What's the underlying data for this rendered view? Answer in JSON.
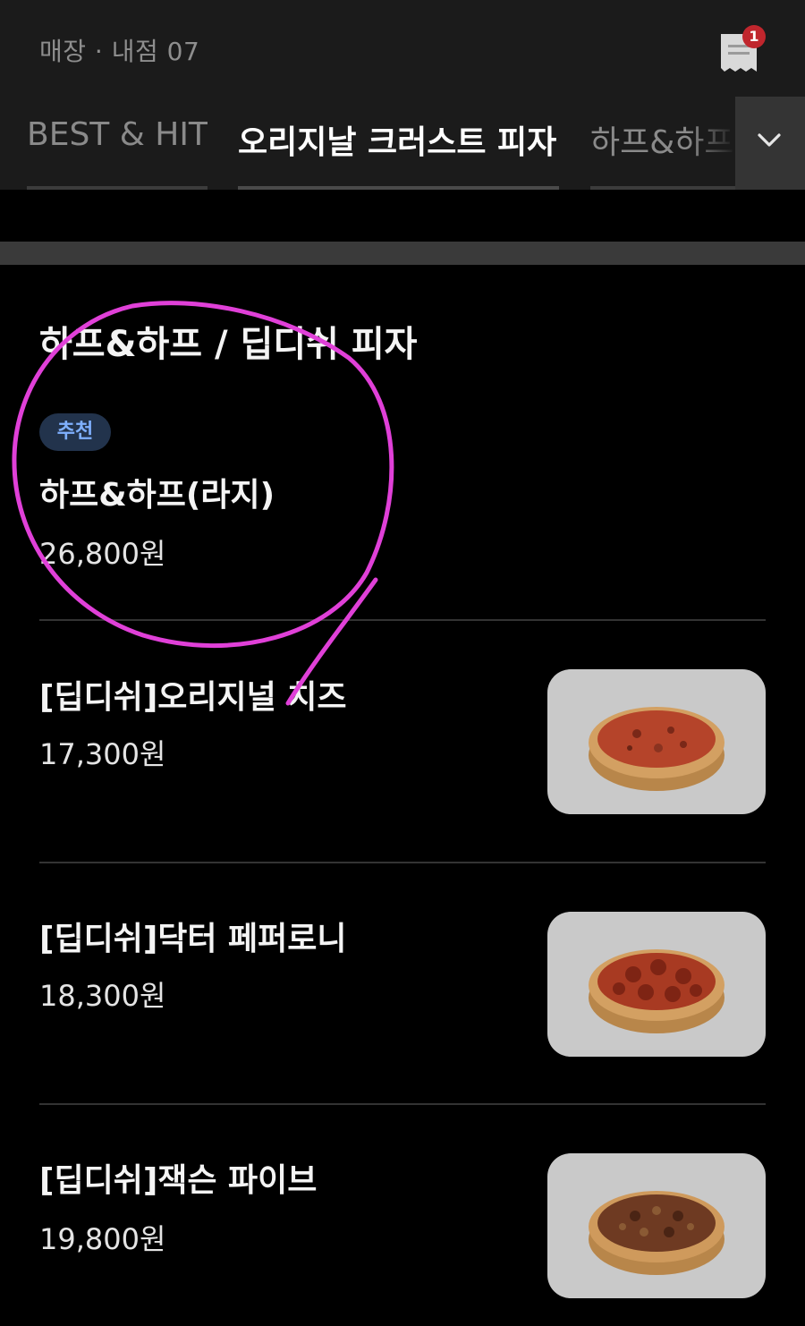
{
  "header": {
    "store_label": "매장 · 내점 07",
    "cart_badge": "1",
    "receipt_icon": "receipt-icon"
  },
  "tabs": [
    {
      "label": "BEST & HIT",
      "active": false
    },
    {
      "label": "오리지날 크러스트 피자",
      "active": true
    },
    {
      "label": "하프&하프",
      "active": false
    }
  ],
  "section": {
    "title": "하프&하프 / 딥디쉬 피자"
  },
  "featured": {
    "badge": "추천",
    "name": "하프&하프(라지)",
    "price": "26,800원"
  },
  "items": [
    {
      "name": "[딥디쉬]오리지널 치즈",
      "price": "17,300원",
      "topping": "cheese"
    },
    {
      "name": "[딥디쉬]닥터 페퍼로니",
      "price": "18,300원",
      "topping": "pepperoni"
    },
    {
      "name": "[딥디쉬]잭슨 파이브",
      "price": "19,800원",
      "topping": "meat"
    }
  ],
  "colors": {
    "annotation": "#e040d8",
    "badge_bg": "#22334c",
    "badge_text": "#7fb0ff",
    "cart_badge": "#c0262d"
  }
}
